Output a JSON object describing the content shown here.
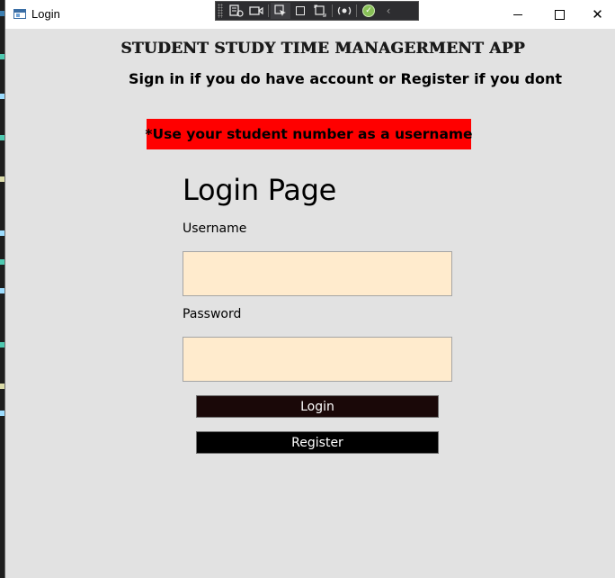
{
  "window": {
    "title": "Login"
  },
  "header": {
    "app_title": "STUDENT STUDY TIME MANAGERMENT APP",
    "subtitle": "Sign in if you do have account or Register if you dont"
  },
  "notice": {
    "text": "*Use your student number as a username",
    "background": "#ff0000"
  },
  "form": {
    "title": "Login Page",
    "username_label": "Username",
    "username_value": "",
    "password_label": "Password",
    "password_value": "",
    "input_background": "#ffebcd",
    "login_label": "Login",
    "register_label": "Register"
  },
  "icons": {
    "window_controls": [
      "minimize-icon",
      "maximize-icon",
      "close-icon"
    ],
    "debug_toolbar": [
      "live-visual-tree-icon",
      "video-icon",
      "select-element-icon",
      "display-layout-adorners-icon",
      "track-focus-icon",
      "hot-reload-icon",
      "binding-check-icon",
      "collapse-chevron-icon"
    ]
  }
}
